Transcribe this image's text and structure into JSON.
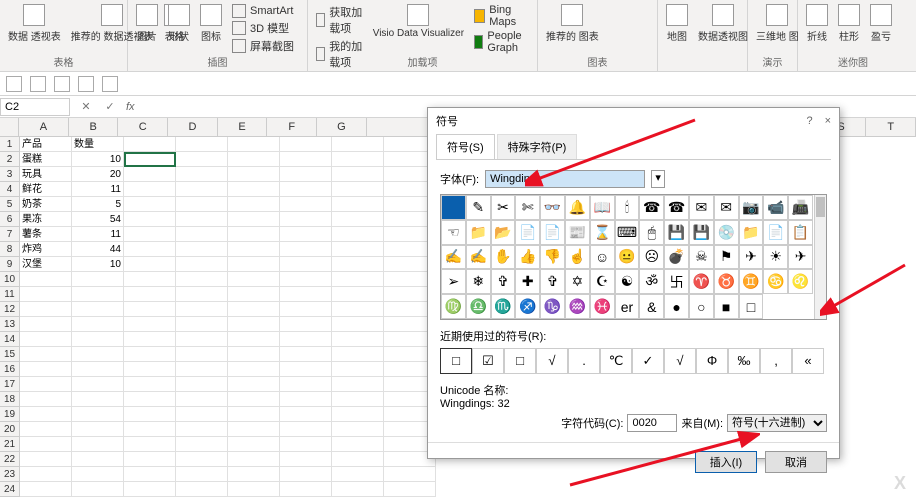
{
  "ribbon": {
    "groups": [
      {
        "name": "表格",
        "items": [
          "数据\n透视表",
          "推荐的\n数据透视表",
          "表格"
        ]
      },
      {
        "name": "插图",
        "items": [
          "图片",
          "形状",
          "图标"
        ],
        "extras": [
          "SmartArt",
          "3D 模型",
          "屏幕截图"
        ]
      },
      {
        "name": "加载项",
        "extras": [
          "获取加载项",
          "我的加载项"
        ],
        "items": [
          "Visio Data\nVisualizer",
          "Bing Maps",
          "People Graph"
        ]
      },
      {
        "name": "图表",
        "items": [
          "推荐的\n图表"
        ]
      },
      {
        "name": "",
        "items": [
          "地图",
          "数据透视图"
        ]
      },
      {
        "name": "演示",
        "items": [
          "三维地\n图"
        ]
      },
      {
        "name": "迷你图",
        "items": [
          "折线",
          "柱形",
          "盈亏"
        ]
      }
    ]
  },
  "namebox": "C2",
  "columns": [
    "A",
    "B",
    "C",
    "D",
    "E",
    "F",
    "G",
    "S",
    "T"
  ],
  "sheet": {
    "headers": [
      "产品",
      "数量"
    ],
    "rows": [
      [
        "蛋糕",
        "10"
      ],
      [
        "玩具",
        "20"
      ],
      [
        "鲜花",
        "11"
      ],
      [
        "奶茶",
        "5"
      ],
      [
        "果冻",
        "54"
      ],
      [
        "薯条",
        "11"
      ],
      [
        "炸鸡",
        "44"
      ],
      [
        "汉堡",
        "10"
      ]
    ]
  },
  "dialog": {
    "title": "符号",
    "help": "?",
    "close": "×",
    "tab1": "符号(S)",
    "tab2": "特殊字符(P)",
    "font_label": "字体(F):",
    "font_value": "Wingdings",
    "symbols": [
      " ",
      "✎",
      "✂",
      "✄",
      "👓",
      "🔔",
      "📖",
      "🕯",
      "☎",
      "☎",
      "✉",
      "✉",
      "📷",
      "📹",
      "📠",
      "☜",
      "📁",
      "📂",
      "📄",
      "📄",
      "📰",
      "⌛",
      "⌨",
      "🖱",
      "💾",
      "💾",
      "💿",
      "📁",
      "📄",
      "📋",
      "✍",
      "✍",
      "✋",
      "👍",
      "👎",
      "☝",
      "☺",
      "😐",
      "☹",
      "💣",
      "☠",
      "⚑",
      "✈",
      "☀",
      "✈",
      "➢",
      "❄",
      "✞",
      "✚",
      "✞",
      "✡",
      "☪",
      "☯",
      "ॐ",
      "卐",
      "♈",
      "♉",
      "♊",
      "♋",
      "♌",
      "♍",
      "♎",
      "♏",
      "♐",
      "♑",
      "♒",
      "♓",
      "er",
      "&",
      "●",
      "○",
      "■",
      "□"
    ],
    "recent_label": "近期使用过的符号(R):",
    "recent": [
      "□",
      "☑",
      "□",
      "√",
      ".",
      "℃",
      "✓",
      "√",
      "Φ",
      "‰",
      ",",
      "«"
    ],
    "unicode_name_label": "Unicode 名称:",
    "unicode_name": "Wingdings: 32",
    "code_label": "字符代码(C):",
    "code_value": "0020",
    "from_label": "来自(M):",
    "from_value": "符号(十六进制)",
    "insert": "插入(I)",
    "cancel": "取消"
  },
  "watermark": "X"
}
